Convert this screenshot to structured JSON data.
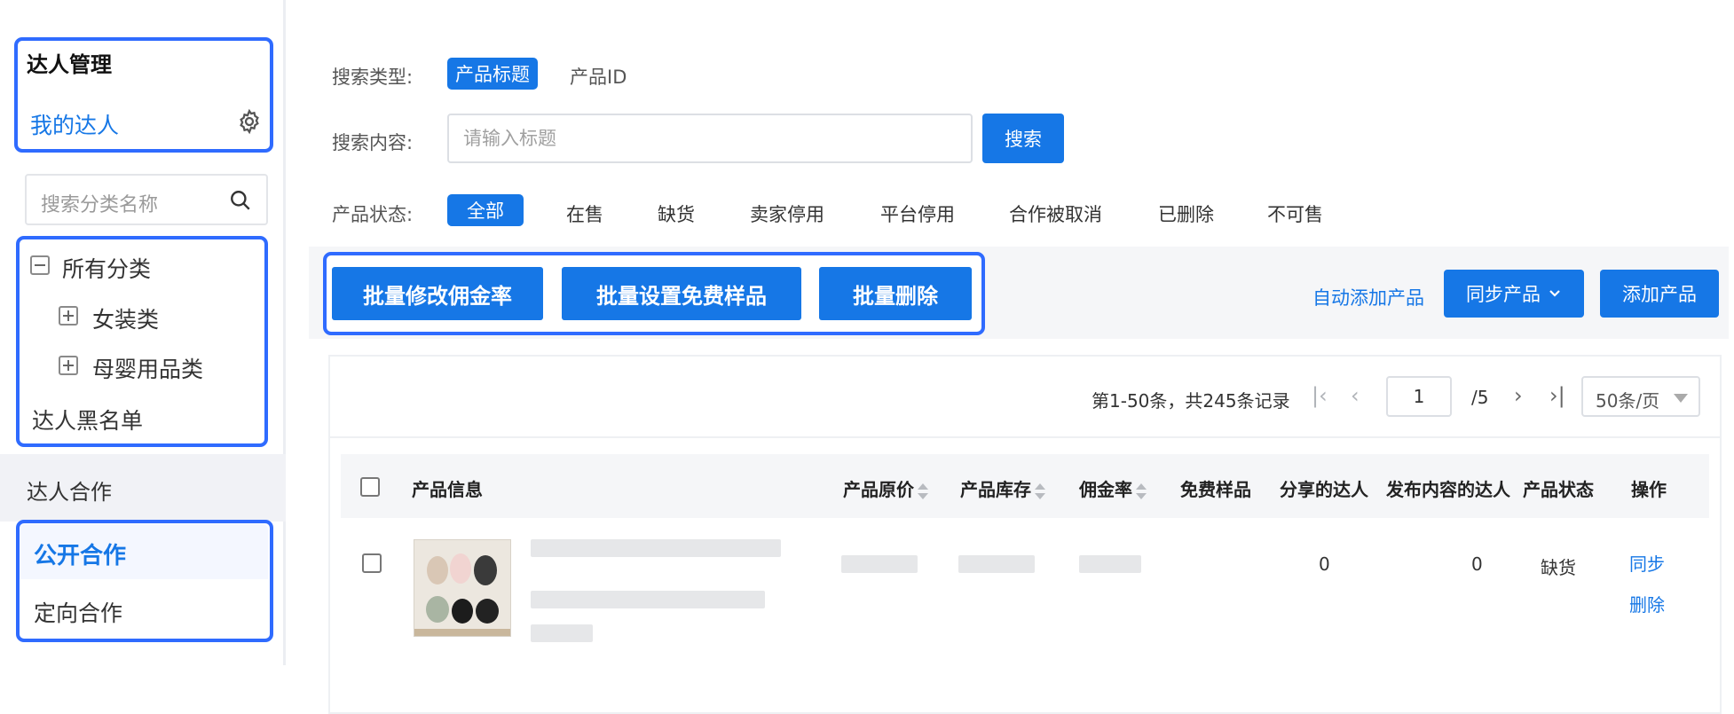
{
  "sidebar": {
    "group_title": "达人管理",
    "my_influencers": "我的达人",
    "category_search_placeholder": "搜索分类名称",
    "categories": {
      "all": "所有分类",
      "children": [
        "女装类",
        "母婴用品类"
      ]
    },
    "blacklist": "达人黑名单",
    "coop_title": "达人合作",
    "coop_items": [
      "公开合作",
      "定向合作"
    ]
  },
  "search": {
    "type_label": "搜索类型:",
    "types": [
      "产品标题",
      "产品ID"
    ],
    "content_label": "搜索内容:",
    "placeholder": "请输入标题",
    "button": "搜索"
  },
  "status": {
    "label": "产品状态:",
    "options": [
      "全部",
      "在售",
      "缺货",
      "卖家停用",
      "平台停用",
      "合作被取消",
      "已删除",
      "不可售"
    ]
  },
  "batch": {
    "edit_rate": "批量修改佣金率",
    "set_sample": "批量设置免费样品",
    "delete": "批量删除"
  },
  "actions": {
    "auto_add": "自动添加产品",
    "sync": "同步产品",
    "add": "添加产品"
  },
  "pagination": {
    "summary": "第1-50条，共245条记录",
    "page": "1",
    "total": "/5",
    "page_size": "50条/页"
  },
  "table": {
    "headers": [
      "产品信息",
      "产品原价",
      "产品库存",
      "佣金率",
      "免费样品",
      "分享的达人",
      "发布内容的达人",
      "产品状态",
      "操作"
    ],
    "rows": [
      {
        "shared": "0",
        "published": "0",
        "status": "缺货",
        "ops": [
          "同步",
          "删除"
        ]
      }
    ]
  },
  "colors": {
    "primary": "#1677e6",
    "highlight": "#2f6bff"
  }
}
